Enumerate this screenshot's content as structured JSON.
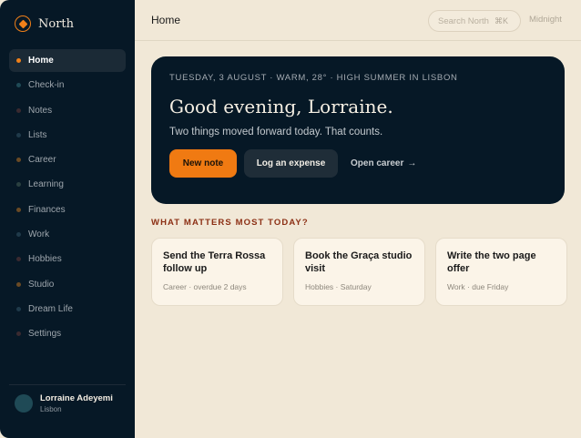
{
  "brand": {
    "name": "North"
  },
  "sidebar": {
    "items": [
      {
        "label": "Home",
        "active": true,
        "dot": "#f08019"
      },
      {
        "label": "Check-in",
        "dot": "#1f4a56"
      },
      {
        "label": "Notes",
        "dot": "#3a2a30"
      },
      {
        "label": "Lists",
        "dot": "#1f3a4a"
      },
      {
        "label": "Career",
        "dot": "#6a4a24"
      },
      {
        "label": "Learning",
        "dot": "#2a4040"
      },
      {
        "label": "Finances",
        "dot": "#6a4a24"
      },
      {
        "label": "Work",
        "dot": "#1f3a4a"
      },
      {
        "label": "Hobbies",
        "dot": "#3a2a30"
      },
      {
        "label": "Studio",
        "dot": "#6a4a24"
      },
      {
        "label": "Dream Life",
        "dot": "#1f3a4a"
      },
      {
        "label": "Settings",
        "dot": "#3a2a30"
      }
    ]
  },
  "user": {
    "name": "Lorraine Adeyemi",
    "location": "Lisbon"
  },
  "topbar": {
    "title": "Home",
    "search_placeholder": "Search North",
    "search_shortcut": "⌘K",
    "theme_label": "Midnight"
  },
  "hero": {
    "kicker": "TUESDAY, 3 AUGUST · WARM, 28° · HIGH SUMMER IN LISBON",
    "greeting": "Good evening, Lorraine.",
    "subtitle": "Two things moved forward today. That counts.",
    "primary_action": "New note",
    "secondary_action": "Log an expense",
    "link_action": "Open career",
    "link_arrow": "→"
  },
  "today": {
    "heading": "WHAT MATTERS MOST TODAY?",
    "cards": [
      {
        "title": "Send the Terra Rossa follow up",
        "meta": "Career · overdue 2 days"
      },
      {
        "title": "Book the Graça studio visit",
        "meta": "Hobbies · Saturday"
      },
      {
        "title": "Write the two page offer",
        "meta": "Work · due Friday"
      }
    ]
  },
  "colors": {
    "sidebar_bg": "#061826",
    "accent": "#f07a12",
    "page_bg": "#f1e8d7",
    "section_heading": "#8c2f14"
  }
}
